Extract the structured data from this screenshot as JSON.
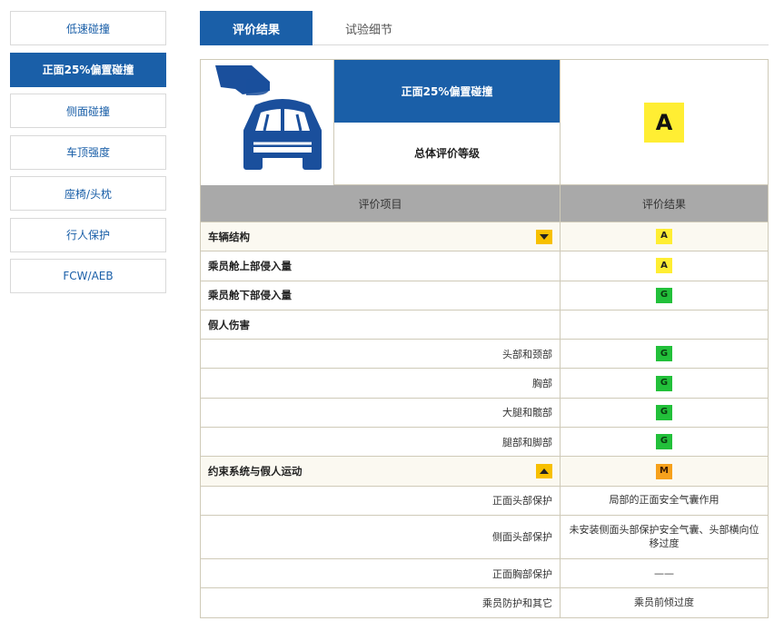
{
  "sidebar": {
    "items": [
      {
        "label": "低速碰撞",
        "active": false
      },
      {
        "label": "正面25%偏置碰撞",
        "active": true
      },
      {
        "label": "侧面碰撞",
        "active": false
      },
      {
        "label": "车顶强度",
        "active": false
      },
      {
        "label": "座椅/头枕",
        "active": false
      },
      {
        "label": "行人保护",
        "active": false
      },
      {
        "label": "FCW/AEB",
        "active": false
      }
    ]
  },
  "tabs": [
    {
      "label": "评价结果",
      "active": true
    },
    {
      "label": "试验细节",
      "active": false
    }
  ],
  "hero": {
    "crash_title": "正面25%偏置碰撞",
    "overall_label": "总体评价等级",
    "overall_rating": "A"
  },
  "table": {
    "headers": {
      "item": "评价项目",
      "result": "评价结果"
    },
    "rows": [
      {
        "label": "车辆结构",
        "rating": "A",
        "toggle": "down"
      },
      {
        "label": "乘员舱上部侵入量",
        "rating": "A"
      },
      {
        "label": "乘员舱下部侵入量",
        "rating": "G"
      },
      {
        "label": "假人伤害",
        "rating": ""
      },
      {
        "label": "头部和颈部",
        "rating": "G"
      },
      {
        "label": "胸部",
        "rating": "G"
      },
      {
        "label": "大腿和髋部",
        "rating": "G"
      },
      {
        "label": "腿部和脚部",
        "rating": "G"
      },
      {
        "label": "约束系统与假人运动",
        "rating": "M",
        "toggle": "up"
      },
      {
        "label": "正面头部保护",
        "text": "局部的正面安全气囊作用"
      },
      {
        "label": "侧面头部保护",
        "text": "未安装侧面头部保护安全气囊、头部横向位移过度"
      },
      {
        "label": "正面胸部保护",
        "text": "——"
      },
      {
        "label": "乘员防护和其它",
        "text": "乘员前倾过度"
      }
    ]
  },
  "colors": {
    "brand_blue": "#1a5fa8",
    "rating_A": "#ffee33",
    "rating_G": "#22c03a",
    "rating_M": "#f6a11c",
    "toggle": "#f7c000"
  }
}
